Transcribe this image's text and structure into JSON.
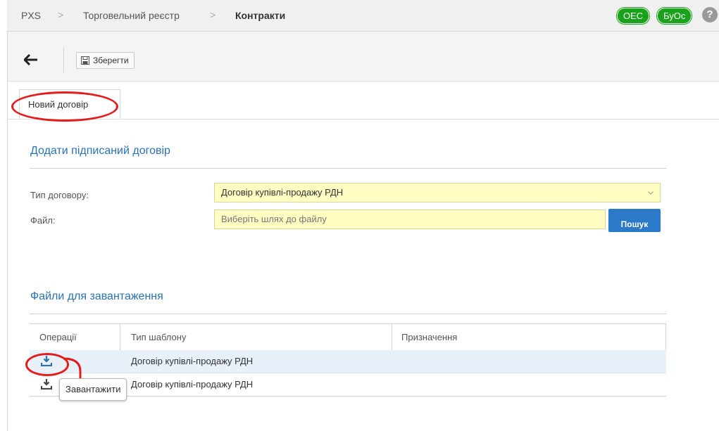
{
  "breadcrumb": {
    "items": [
      "PXS",
      "Торговельний реєстр",
      "Контракти"
    ],
    "separator": ">"
  },
  "badges": [
    {
      "label": "OEC",
      "color": "#1aa31a"
    },
    {
      "label": "БуОс",
      "color": "#1aa31a"
    }
  ],
  "help_label": "?",
  "toolbar": {
    "save_label": "Зберегти",
    "back_icon": "arrow-left-icon",
    "save_icon": "floppy-disk-icon"
  },
  "tab": {
    "label": "Новий договір"
  },
  "form": {
    "title": "Додати підписаний договір",
    "contract_type_label": "Тип договору:",
    "contract_type_value": "Договір купівлі-продажу РДН",
    "file_label": "Файл:",
    "file_placeholder": "Виберіть шлях до файлу",
    "search_label": "Пошук"
  },
  "files": {
    "title": "Файли для завантаження",
    "columns": [
      "Операції",
      "Тип шаблону",
      "Призначення"
    ],
    "rows": [
      {
        "template_type": "Договір купівлі-продажу РДН",
        "purpose": ""
      },
      {
        "template_type": "Договір купівлі-продажу РДН",
        "purpose": ""
      }
    ],
    "tooltip": "Завантажити"
  },
  "colors": {
    "accent": "#2a72b5",
    "annotation": "#e31d1d",
    "field_bg": "#fffdc2",
    "button": "#2b7ac9"
  }
}
